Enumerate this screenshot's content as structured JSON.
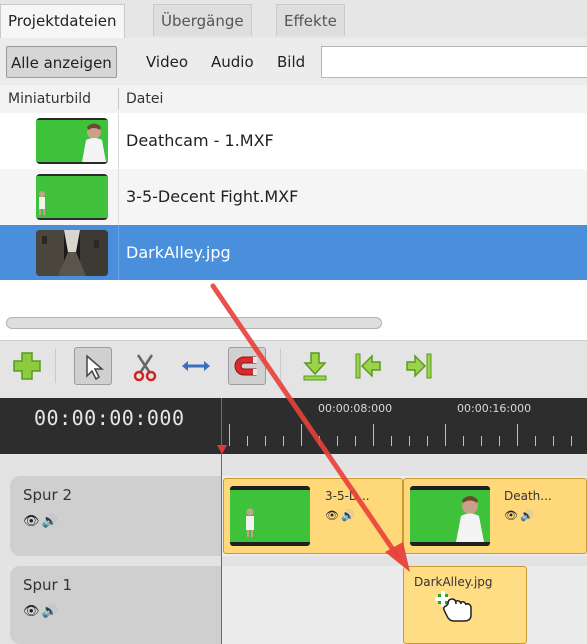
{
  "tabs": [
    {
      "label": "Projektdateien",
      "active": true
    },
    {
      "label": "Übergänge",
      "active": false
    },
    {
      "label": "Effekte",
      "active": false
    }
  ],
  "filters": [
    {
      "label": "Alle anzeigen",
      "active": true
    },
    {
      "label": "Video",
      "active": false
    },
    {
      "label": "Audio",
      "active": false
    },
    {
      "label": "Bild",
      "active": false
    }
  ],
  "search": {
    "value": "",
    "placeholder": ""
  },
  "columns": {
    "thumbnail": "Miniaturbild",
    "file": "Datei"
  },
  "files": [
    {
      "name": "Deathcam - 1.MXF",
      "thumb": "green-screen-person-closeup",
      "selected": false
    },
    {
      "name": "3-5-Decent Fight.MXF",
      "thumb": "green-screen-person-small",
      "selected": false
    },
    {
      "name": "DarkAlley.jpg",
      "thumb": "dark-alley",
      "selected": true
    }
  ],
  "toolbar": {
    "icons": [
      "add-track-icon",
      "select-pointer-icon",
      "razor-scissors-icon",
      "snap-arrows-icon",
      "magnet-icon",
      "import-arrow-icon",
      "jump-start-icon",
      "jump-end-icon"
    ]
  },
  "timeline": {
    "timecode": "00:00:00:000",
    "ruler_labels": [
      "00:00:08:000",
      "00:00:16:000"
    ]
  },
  "tracks": [
    {
      "name": "Spur 2",
      "clips": [
        {
          "title": "3-5-D...",
          "thumb": "green-screen-person-small"
        },
        {
          "title": "Death...",
          "thumb": "green-screen-person-closeup"
        }
      ]
    },
    {
      "name": "Spur 1",
      "clips": [
        {
          "title": "DarkAlley.jpg"
        }
      ]
    }
  ],
  "colors": {
    "accent": "#4a8fdb",
    "clip": "#ffd879",
    "playhead": "#e03a3a",
    "annotation_arrow": "#e8413a"
  }
}
